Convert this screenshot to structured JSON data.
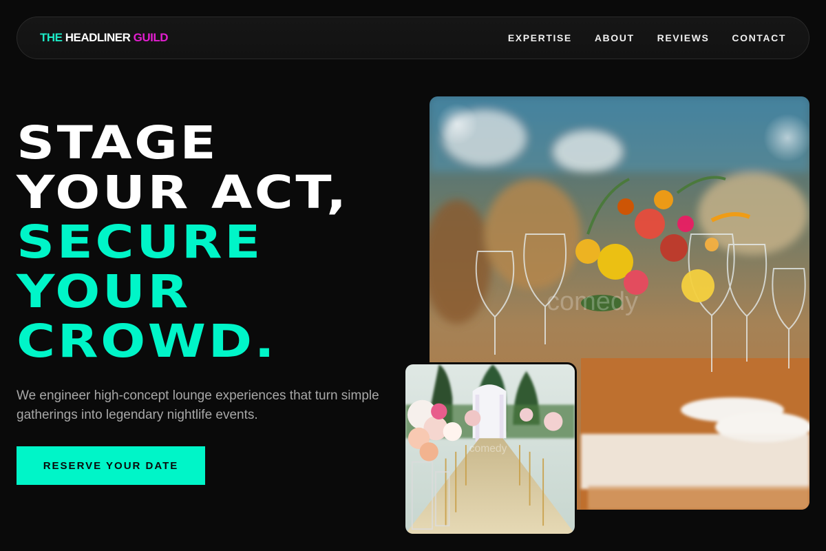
{
  "brand": {
    "part1": "THE",
    "part2": "HEADLINER",
    "part3": "GUILD"
  },
  "nav": {
    "items": [
      {
        "label": "EXPERTISE"
      },
      {
        "label": "ABOUT"
      },
      {
        "label": "REVIEWS"
      },
      {
        "label": "CONTACT"
      }
    ]
  },
  "hero": {
    "title_lines": [
      "STAGE",
      "YOUR ACT,",
      "SECURE",
      "YOUR",
      "CROWD."
    ],
    "subtitle": "We engineer high-concept lounge experiences that turn simple gatherings into legendary nightlife events.",
    "cta_label": "RESERVE YOUR DATE"
  },
  "images": {
    "main": {
      "description": "event-table-flowers-photo",
      "watermark": "comedy"
    },
    "small": {
      "description": "outdoor-wedding-aisle-photo",
      "watermark": "comedy"
    }
  },
  "colors": {
    "accent": "#00f5c8",
    "brand_teal": "#1de9c6",
    "brand_magenta": "#e21ecf",
    "background": "#0a0a0a"
  }
}
